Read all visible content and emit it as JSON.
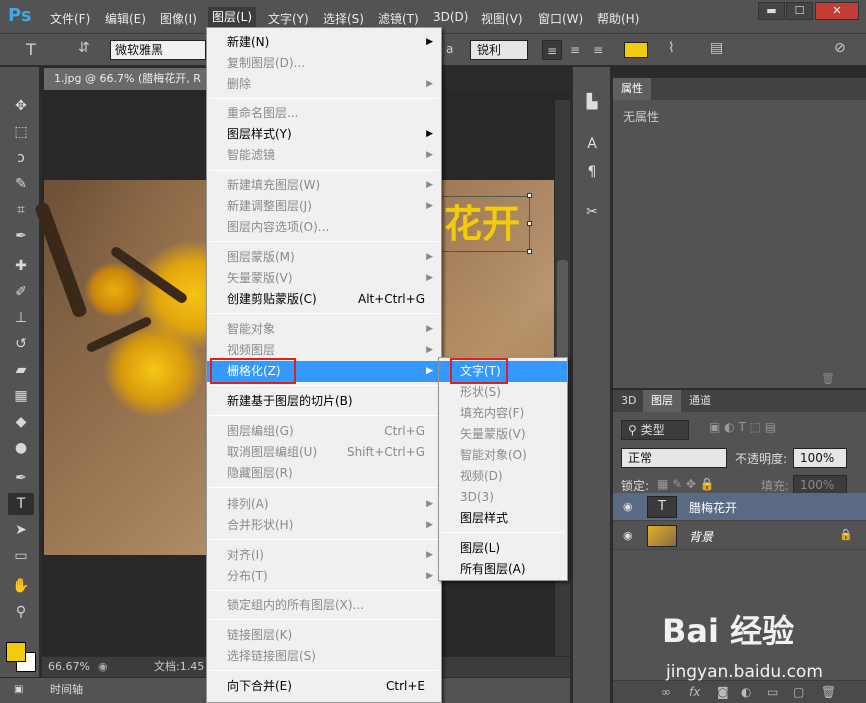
{
  "app": {
    "logo": "Ps"
  },
  "menubar": {
    "items": [
      "文件(F)",
      "编辑(E)",
      "图像(I)",
      "图层(L)",
      "文字(Y)",
      "选择(S)",
      "滤镜(T)",
      "3D(D)",
      "视图(V)",
      "窗口(W)",
      "帮助(H)"
    ],
    "active": "图层(L)"
  },
  "window_buttons": {
    "minimize": "▬",
    "maximize": "☐",
    "close": "✕"
  },
  "options": {
    "font_family": "微软雅黑",
    "aa_prefix": "a",
    "anti_alias": "锐利",
    "text_color": "#f2cc0c"
  },
  "document": {
    "tab_title": "1.jpg @ 66.7% (腊梅花开, R",
    "canvas_text": "花开",
    "zoom": "66.67%",
    "doc_info": "文档:1.45"
  },
  "timeline": {
    "label": "时间轴"
  },
  "layer_menu": {
    "items": [
      {
        "label": "新建(N)",
        "disabled": false,
        "submenu": true,
        "shortcut": ""
      },
      {
        "label": "复制图层(D)...",
        "disabled": true,
        "submenu": false,
        "shortcut": ""
      },
      {
        "label": "删除",
        "disabled": true,
        "submenu": true,
        "shortcut": ""
      },
      {
        "label": "重命名图层...",
        "disabled": true,
        "submenu": false,
        "shortcut": ""
      },
      {
        "label": "图层样式(Y)",
        "disabled": false,
        "submenu": true,
        "shortcut": ""
      },
      {
        "label": "智能滤镜",
        "disabled": true,
        "submenu": true,
        "shortcut": ""
      },
      {
        "label": "新建填充图层(W)",
        "disabled": true,
        "submenu": true,
        "shortcut": ""
      },
      {
        "label": "新建调整图层(J)",
        "disabled": true,
        "submenu": true,
        "shortcut": ""
      },
      {
        "label": "图层内容选项(O)...",
        "disabled": true,
        "submenu": false,
        "shortcut": ""
      },
      {
        "label": "图层蒙版(M)",
        "disabled": true,
        "submenu": true,
        "shortcut": ""
      },
      {
        "label": "矢量蒙版(V)",
        "disabled": true,
        "submenu": true,
        "shortcut": ""
      },
      {
        "label": "创建剪贴蒙版(C)",
        "disabled": false,
        "submenu": false,
        "shortcut": "Alt+Ctrl+G"
      },
      {
        "label": "智能对象",
        "disabled": true,
        "submenu": true,
        "shortcut": ""
      },
      {
        "label": "视频图层",
        "disabled": true,
        "submenu": true,
        "shortcut": ""
      },
      {
        "label": "栅格化(Z)",
        "disabled": false,
        "submenu": true,
        "shortcut": "",
        "highlighted": true
      },
      {
        "label": "新建基于图层的切片(B)",
        "disabled": false,
        "submenu": false,
        "shortcut": ""
      },
      {
        "label": "图层编组(G)",
        "disabled": true,
        "submenu": false,
        "shortcut": "Ctrl+G"
      },
      {
        "label": "取消图层编组(U)",
        "disabled": true,
        "submenu": false,
        "shortcut": "Shift+Ctrl+G"
      },
      {
        "label": "隐藏图层(R)",
        "disabled": true,
        "submenu": false,
        "shortcut": ""
      },
      {
        "label": "排列(A)",
        "disabled": true,
        "submenu": true,
        "shortcut": ""
      },
      {
        "label": "合并形状(H)",
        "disabled": true,
        "submenu": true,
        "shortcut": ""
      },
      {
        "label": "对齐(I)",
        "disabled": true,
        "submenu": true,
        "shortcut": ""
      },
      {
        "label": "分布(T)",
        "disabled": true,
        "submenu": true,
        "shortcut": ""
      },
      {
        "label": "锁定组内的所有图层(X)...",
        "disabled": true,
        "submenu": false,
        "shortcut": ""
      },
      {
        "label": "链接图层(K)",
        "disabled": true,
        "submenu": false,
        "shortcut": ""
      },
      {
        "label": "选择链接图层(S)",
        "disabled": true,
        "submenu": false,
        "shortcut": ""
      },
      {
        "label": "向下合并(E)",
        "disabled": false,
        "submenu": false,
        "shortcut": "Ctrl+E"
      }
    ]
  },
  "rasterize_menu": {
    "items": [
      {
        "label": "文字(T)",
        "disabled": false,
        "highlighted": true
      },
      {
        "label": "形状(S)",
        "disabled": true
      },
      {
        "label": "填充内容(F)",
        "disabled": true
      },
      {
        "label": "矢量蒙版(V)",
        "disabled": true
      },
      {
        "label": "智能对象(O)",
        "disabled": true
      },
      {
        "label": "视频(D)",
        "disabled": true
      },
      {
        "label": "3D(3)",
        "disabled": true
      },
      {
        "label": "图层样式",
        "disabled": false
      },
      {
        "label": "图层(L)",
        "disabled": false
      },
      {
        "label": "所有图层(A)",
        "disabled": false
      }
    ]
  },
  "properties_panel": {
    "tab": "属性",
    "empty_text": "无属性"
  },
  "layers_panel": {
    "tabs": [
      "3D",
      "图层",
      "通道"
    ],
    "active_tab": "图层",
    "filter_label": "类型",
    "blend_mode": "正常",
    "opacity_label": "不透明度:",
    "opacity_value": "100%",
    "lock_label": "锁定:",
    "fill_label": "填充:",
    "fill_value": "100%",
    "layers": [
      {
        "name": "腊梅花开",
        "type": "text",
        "selected": true,
        "thumb_glyph": "T"
      },
      {
        "name": "背景",
        "type": "image",
        "selected": false,
        "locked": true
      }
    ]
  },
  "watermark": {
    "logo": "Bai 经验",
    "url": "jingyan.baidu.com"
  }
}
